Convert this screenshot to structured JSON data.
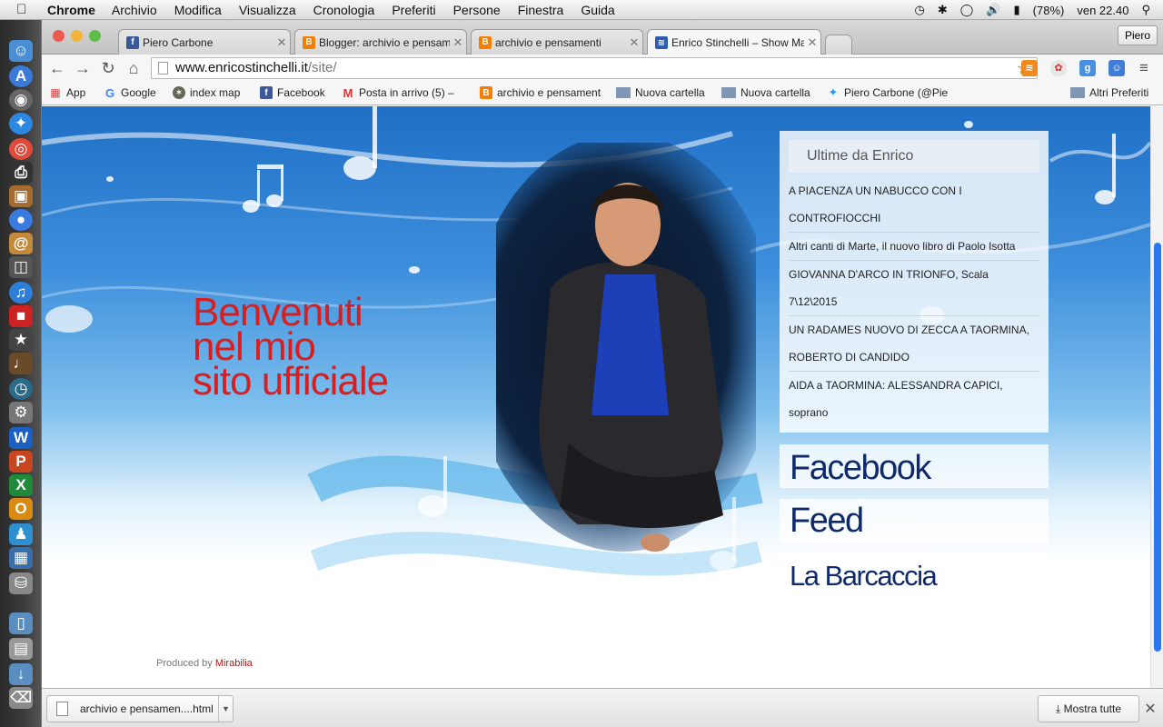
{
  "menubar": {
    "app": "Chrome",
    "items": [
      "Archivio",
      "Modifica",
      "Visualizza",
      "Cronologia",
      "Preferiti",
      "Persone",
      "Finestra",
      "Guida"
    ],
    "battery": "(78%)",
    "clock": "ven 22.40"
  },
  "tabs": [
    {
      "label": "Piero Carbone",
      "icon": "facebook-icon",
      "color": "#3b5998"
    },
    {
      "label": "Blogger: archivio e pensam",
      "icon": "blogger-icon",
      "color": "#f57d00"
    },
    {
      "label": "archivio e pensamenti",
      "icon": "blogger-icon",
      "color": "#f57d00"
    },
    {
      "label": "Enrico Stinchelli – Show Ma",
      "icon": "site-icon",
      "color": "#2a5db0"
    }
  ],
  "profile_button": "Piero",
  "omnibox": {
    "host": "www.enricostinchelli.it",
    "path": "/site/"
  },
  "bookmarks": [
    {
      "label": "App",
      "icon": "apps-grid-icon"
    },
    {
      "label": "Google",
      "icon": "google-icon"
    },
    {
      "label": "index map",
      "icon": "map-icon"
    },
    {
      "label": "Facebook",
      "icon": "facebook-icon"
    },
    {
      "label": "Posta in arrivo (5) –",
      "icon": "gmail-icon"
    },
    {
      "label": "archivio e pensamenti",
      "icon": "blogger-icon"
    },
    {
      "label": "Nuova cartella",
      "icon": "folder-icon"
    },
    {
      "label": "Nuova cartella",
      "icon": "folder-icon"
    },
    {
      "label": "Piero Carbone (@Pie",
      "icon": "twitter-icon"
    }
  ],
  "other_bookmarks": "Altri Preferiti",
  "page": {
    "welcome_lines": [
      "Benvenuti",
      "nel mio",
      "sito ufficiale"
    ],
    "news_title": "Ultime da Enrico",
    "news": [
      "A PIACENZA UN NABUCCO CON I CONTROFIOCCHI",
      "Altri canti di Marte, il nuovo libro di Paolo Isotta",
      "GIOVANNA D'ARCO IN TRIONFO, Scala 7\\12\\2015",
      "UN RADAMES NUOVO DI ZECCA A TAORMINA, ROBERTO DI CANDIDO",
      "AIDA a TAORMINA: ALESSANDRA CAPICI, soprano"
    ],
    "links": {
      "facebook": "Facebook",
      "feed": "Feed",
      "barcaccia": "La Barcaccia"
    },
    "produced_by": "Produced by",
    "produced_link": "Mirabilia"
  },
  "downloads": {
    "file": "archivio e pensamen....html",
    "show_all": "Mostra tutte"
  },
  "colors": {
    "accent_red": "#d81e1e",
    "link_navy": "#0e2a6b",
    "sky_blue": "#3d8fdc"
  }
}
